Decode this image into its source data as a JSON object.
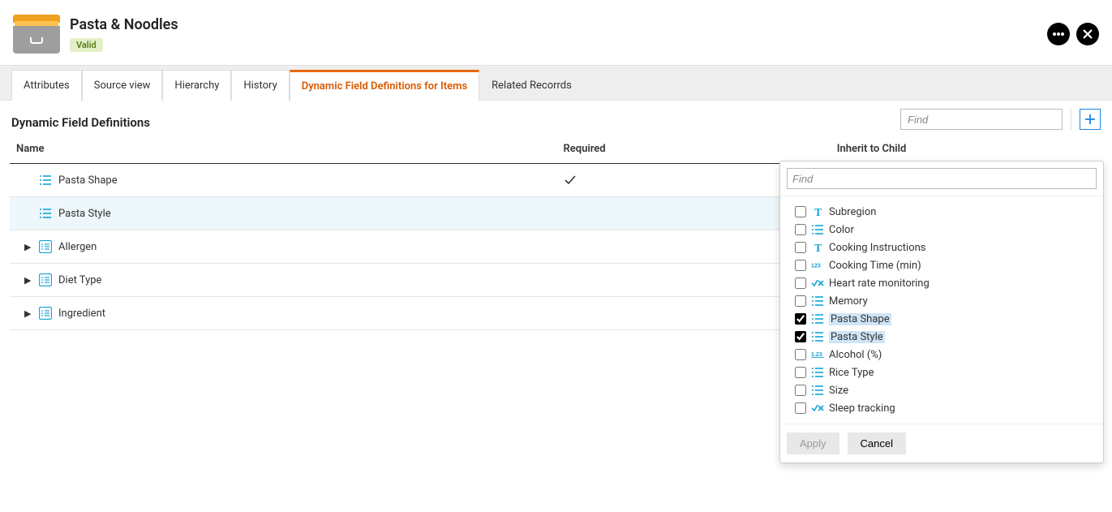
{
  "header": {
    "title": "Pasta & Noodles",
    "status": "Valid"
  },
  "tabs": [
    {
      "label": "Attributes",
      "active": false,
      "boxed": true
    },
    {
      "label": "Source view",
      "active": false,
      "boxed": true
    },
    {
      "label": "Hierarchy",
      "active": false,
      "boxed": true
    },
    {
      "label": "History",
      "active": false,
      "boxed": true
    },
    {
      "label": "Dynamic Field Definitions for Items",
      "active": true,
      "boxed": true
    },
    {
      "label": "Related Recorrds",
      "active": false,
      "boxed": false
    }
  ],
  "section": {
    "title": "Dynamic Field Definitions",
    "find_placeholder": "Find"
  },
  "columns": {
    "name": "Name",
    "required": "Required",
    "inherit": "Inherit to Child"
  },
  "rows": [
    {
      "name": "Pasta Shape",
      "icon": "list",
      "expandable": false,
      "required": true,
      "inherit": true,
      "highlight": false
    },
    {
      "name": "Pasta Style",
      "icon": "list",
      "expandable": false,
      "required": false,
      "inherit": true,
      "highlight": true
    },
    {
      "name": "Allergen",
      "icon": "multi",
      "expandable": true,
      "required": false,
      "inherit": true,
      "highlight": false
    },
    {
      "name": "Diet Type",
      "icon": "multi",
      "expandable": true,
      "required": false,
      "inherit": true,
      "highlight": false
    },
    {
      "name": "Ingredient",
      "icon": "multi",
      "expandable": true,
      "required": false,
      "inherit": true,
      "highlight": false
    }
  ],
  "dropdown": {
    "find_placeholder": "Find",
    "items": [
      {
        "label": "Subregion",
        "icon": "text",
        "checked": false
      },
      {
        "label": "Color",
        "icon": "list",
        "checked": false
      },
      {
        "label": "Cooking Instructions",
        "icon": "text",
        "checked": false
      },
      {
        "label": "Cooking Time (min)",
        "icon": "int",
        "checked": false
      },
      {
        "label": "Heart rate monitoring",
        "icon": "bool",
        "checked": false
      },
      {
        "label": "Memory",
        "icon": "list",
        "checked": false
      },
      {
        "label": "Pasta Shape",
        "icon": "list",
        "checked": true
      },
      {
        "label": "Pasta Style",
        "icon": "list",
        "checked": true
      },
      {
        "label": "Alcohol (%)",
        "icon": "decimal",
        "checked": false
      },
      {
        "label": "Rice Type",
        "icon": "list",
        "checked": false
      },
      {
        "label": "Size",
        "icon": "list",
        "checked": false
      },
      {
        "label": "Sleep tracking",
        "icon": "bool",
        "checked": false
      }
    ],
    "apply": "Apply",
    "cancel": "Cancel"
  }
}
